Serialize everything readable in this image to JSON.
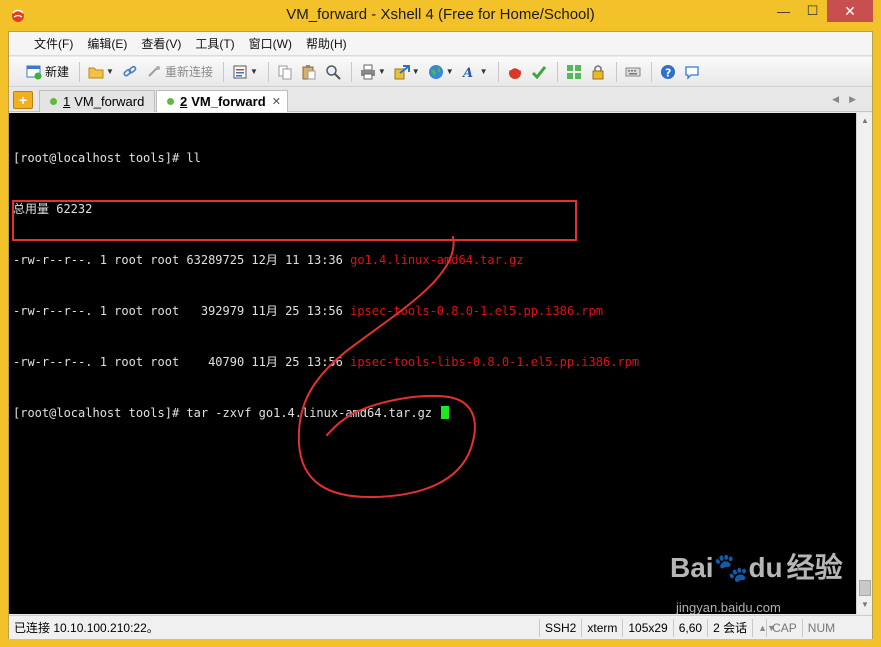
{
  "window": {
    "title": "VM_forward - Xshell 4 (Free for Home/School)",
    "minimize_glyph": "—",
    "maximize_glyph": "☐",
    "close_glyph": "✕"
  },
  "menu": [
    "文件(F)",
    "编辑(E)",
    "查看(V)",
    "工具(T)",
    "窗口(W)",
    "帮助(H)"
  ],
  "toolbar": {
    "new_label": "新建",
    "reconnect_label": "重新连接"
  },
  "tabs": [
    {
      "num": "1",
      "label": "VM_forward",
      "active": false
    },
    {
      "num": "2",
      "label": "VM_forward",
      "active": true
    }
  ],
  "terminal": {
    "lines": [
      {
        "text": "[root@localhost tools]# ll",
        "file": ""
      },
      {
        "text": "总用量 62232",
        "file": ""
      },
      {
        "text": "-rw-r--r--. 1 root root 63289725 12月 11 13:36 ",
        "file": "go1.4.linux-amd64.tar.gz"
      },
      {
        "text": "-rw-r--r--. 1 root root   392979 11月 25 13:56 ",
        "file": "ipsec-tools-0.8.0-1.el5.pp.i386.rpm"
      },
      {
        "text": "-rw-r--r--. 1 root root    40790 11月 25 13:56 ",
        "file": "ipsec-tools-libs-0.8.0-1.el5.pp.i386.rpm"
      },
      {
        "text": "[root@localhost tools]# tar -zxvf go1.4.linux-amd64.tar.gz ",
        "file": ""
      }
    ]
  },
  "watermark": {
    "brand": "Bai",
    "brand2": "du",
    "suffix": "经验",
    "url": "jingyan.baidu.com"
  },
  "statusbar": {
    "connection": "已连接 10.10.100.210:22。",
    "protocol": "SSH2",
    "term": "xterm",
    "size": "105x29",
    "cursor": "6,60",
    "sessions": "2 会话",
    "cap": "CAP",
    "num": "NUM"
  },
  "colors": {
    "terminal_bg": "#000000",
    "listing_highlight": "#e01010",
    "cursor": "#1ee81e",
    "annotation": "#e53030"
  }
}
